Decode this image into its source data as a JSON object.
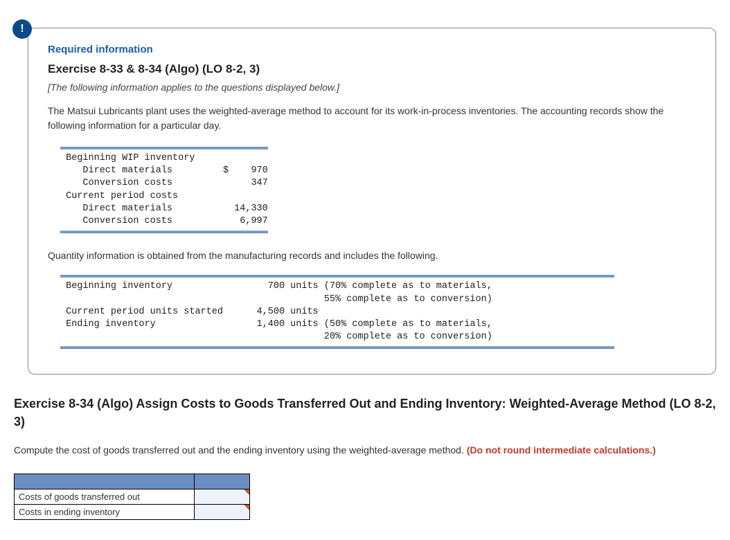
{
  "alert_icon": "!",
  "info_box": {
    "required_label": "Required information",
    "exercise_title": "Exercise 8-33 & 8-34 (Algo) (LO 8-2, 3)",
    "following_note": "[The following information applies to the questions displayed below.]",
    "problem_text": "The Matsui Lubricants plant uses the weighted-average method to account for its work-in-process inventories. The accounting records show the following information for a particular day.",
    "cost_block": " Beginning WIP inventory\n    Direct materials         $    970\n    Conversion costs              347\n Current period costs\n    Direct materials           14,330\n    Conversion costs            6,997",
    "mid_text": "Quantity information is obtained from the manufacturing records and includes the following.",
    "qty_block": " Beginning inventory                 700 units (70% complete as to materials,\n                                               55% complete as to conversion)\n Current period units started      4,500 units\n Ending inventory                  1,400 units (50% complete as to materials,\n                                               20% complete as to conversion)"
  },
  "section2": {
    "title": "Exercise 8-34 (Algo) Assign Costs to Goods Transferred Out and Ending Inventory: Weighted-Average Method (LO 8-2, 3)",
    "compute_text_part1": "Compute the cost of goods transferred out and the ending inventory using the weighted-average method. ",
    "compute_text_red": "(Do not round intermediate calculations.)",
    "table": {
      "row1_label": "Costs of goods transferred out",
      "row2_label": "Costs in ending inventory"
    }
  },
  "chart_data": {
    "type": "table",
    "title": "Cost and quantity information — Matsui Lubricants (weighted-average)",
    "cost_info": {
      "beginning_wip": {
        "direct_materials": 970,
        "conversion_costs": 347
      },
      "current_period": {
        "direct_materials": 14330,
        "conversion_costs": 6997
      }
    },
    "quantity_info": {
      "beginning_inventory": {
        "units": 700,
        "pct_complete_materials": 70,
        "pct_complete_conversion": 55
      },
      "current_period_units_started": 4500,
      "ending_inventory": {
        "units": 1400,
        "pct_complete_materials": 50,
        "pct_complete_conversion": 20
      }
    },
    "answer_rows": [
      "Costs of goods transferred out",
      "Costs in ending inventory"
    ]
  }
}
